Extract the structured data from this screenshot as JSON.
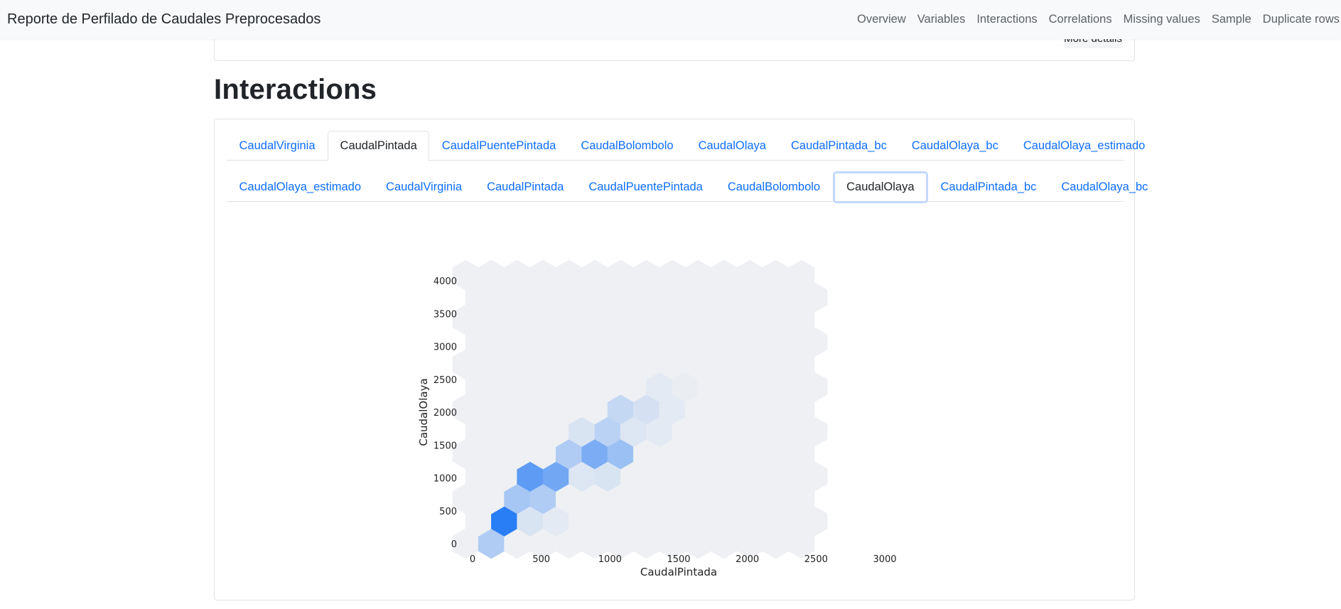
{
  "navbar": {
    "title": "Reporte de Perfilado de Caudales Preprocesados",
    "links": [
      "Overview",
      "Variables",
      "Interactions",
      "Correlations",
      "Missing values",
      "Sample",
      "Duplicate rows"
    ]
  },
  "previous_card": {
    "button_label": "More details"
  },
  "section": {
    "title": "Interactions"
  },
  "tabs_outer": {
    "items": [
      "CaudalVirginia",
      "CaudalPintada",
      "CaudalPuentePintada",
      "CaudalBolombolo",
      "CaudalOlaya",
      "CaudalPintada_bc",
      "CaudalOlaya_bc",
      "CaudalOlaya_estimado"
    ],
    "active": "CaudalPintada"
  },
  "tabs_inner": {
    "items": [
      "CaudalOlaya_estimado",
      "CaudalVirginia",
      "CaudalPintada",
      "CaudalPuentePintada",
      "CaudalBolombolo",
      "CaudalOlaya",
      "CaudalPintada_bc",
      "CaudalOlaya_bc"
    ],
    "active": "CaudalOlaya"
  },
  "colors": {
    "link": "#0d6efd",
    "hex_high": "#1f77f5",
    "hex_low": "#eef0f3"
  },
  "chart_data": {
    "type": "heatmap",
    "subtype": "hexbin",
    "xlabel": "CaudalPintada",
    "ylabel": "CaudalOlaya",
    "xlim": [
      0,
      3000
    ],
    "ylim": [
      0,
      4000
    ],
    "xticks": [
      0,
      500,
      1000,
      1500,
      2000,
      2500,
      3000
    ],
    "yticks": [
      0,
      500,
      1000,
      1500,
      2000,
      2500,
      3000,
      3500,
      4000
    ],
    "grid": false,
    "legend": "none",
    "cells": [
      {
        "x": 125,
        "y": 150,
        "v": 0.3
      },
      {
        "x": 250,
        "y": 400,
        "v": 0.95
      },
      {
        "x": 375,
        "y": 400,
        "v": 1.0
      },
      {
        "x": 312,
        "y": 650,
        "v": 0.35
      },
      {
        "x": 437,
        "y": 650,
        "v": 1.0
      },
      {
        "x": 375,
        "y": 900,
        "v": 0.15
      },
      {
        "x": 500,
        "y": 900,
        "v": 0.7
      },
      {
        "x": 625,
        "y": 900,
        "v": 0.55
      },
      {
        "x": 562,
        "y": 650,
        "v": 0.3
      },
      {
        "x": 562,
        "y": 1150,
        "v": 0.1
      },
      {
        "x": 687,
        "y": 1150,
        "v": 0.6
      },
      {
        "x": 812,
        "y": 1150,
        "v": 0.5
      },
      {
        "x": 750,
        "y": 900,
        "v": 0.15
      },
      {
        "x": 625,
        "y": 1400,
        "v": 0.1
      },
      {
        "x": 750,
        "y": 1400,
        "v": 0.3
      },
      {
        "x": 875,
        "y": 1400,
        "v": 0.55
      },
      {
        "x": 1000,
        "y": 1400,
        "v": 0.4
      },
      {
        "x": 937,
        "y": 1150,
        "v": 0.25
      },
      {
        "x": 812,
        "y": 1650,
        "v": 0.1
      },
      {
        "x": 937,
        "y": 1650,
        "v": 0.3
      },
      {
        "x": 1062,
        "y": 1650,
        "v": 0.25
      },
      {
        "x": 1062,
        "y": 1150,
        "v": 0.1
      },
      {
        "x": 1000,
        "y": 1900,
        "v": 0.15
      },
      {
        "x": 1125,
        "y": 1900,
        "v": 0.2
      },
      {
        "x": 1250,
        "y": 1900,
        "v": 0.12
      },
      {
        "x": 1187,
        "y": 1650,
        "v": 0.08
      },
      {
        "x": 1187,
        "y": 2150,
        "v": 0.1
      },
      {
        "x": 1312,
        "y": 2150,
        "v": 0.12
      },
      {
        "x": 1437,
        "y": 2150,
        "v": 0.05
      },
      {
        "x": 1312,
        "y": 1650,
        "v": 0.05
      },
      {
        "x": 1375,
        "y": 2400,
        "v": 0.05
      },
      {
        "x": 1500,
        "y": 2400,
        "v": 0.04
      },
      {
        "x": 1625,
        "y": 2400,
        "v": 0.02
      },
      {
        "x": 875,
        "y": 900,
        "v": 0.08
      },
      {
        "x": 500,
        "y": 400,
        "v": 0.1
      },
      {
        "x": 625,
        "y": 400,
        "v": 0.05
      }
    ]
  }
}
